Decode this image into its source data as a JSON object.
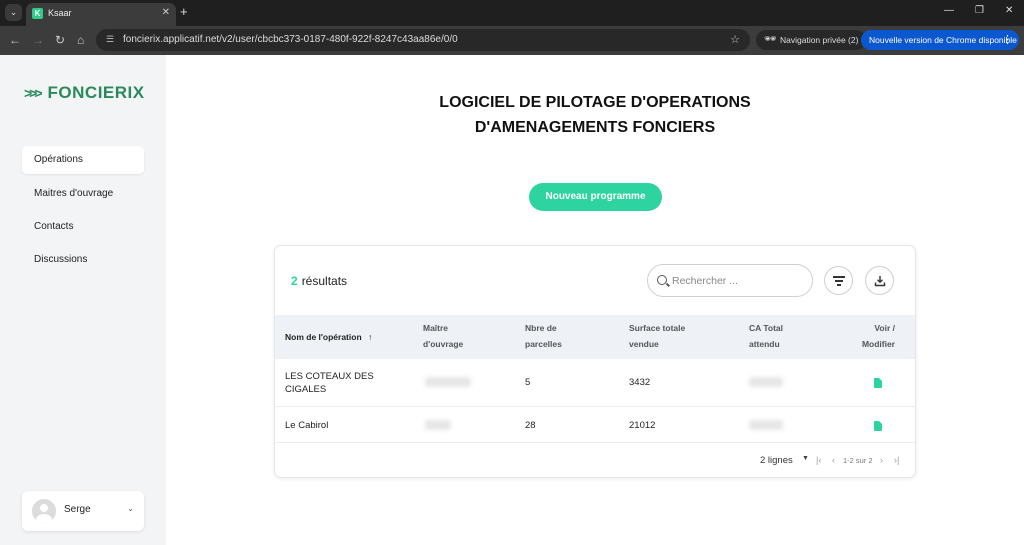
{
  "browser": {
    "tab_title": "Ksaar",
    "url": "foncierix.applicatif.net/v2/user/cbcbc373-0187-480f-922f-8247c43aa86e/0/0",
    "incognito_label": "Navigation privée (2)",
    "update_label": "Nouvelle version de Chrome disponible"
  },
  "sidebar": {
    "logo_text": "FONCIERIX",
    "nav": [
      {
        "label": "Opérations",
        "active": true
      },
      {
        "label": "Maitres d'ouvrage",
        "active": false
      },
      {
        "label": "Contacts",
        "active": false
      },
      {
        "label": "Discussions",
        "active": false
      }
    ],
    "user": {
      "name": "Serge"
    }
  },
  "main": {
    "title_line1": "LOGICIEL DE PILOTAGE D'OPERATIONS",
    "title_line2": "D'AMENAGEMENTS FONCIERS",
    "new_program_label": "Nouveau programme"
  },
  "table": {
    "result_count": "2",
    "result_label": "résultats",
    "search_placeholder": "Rechercher ...",
    "columns": {
      "name": "Nom de l'opération",
      "maitre_l1": "Maître",
      "maitre_l2": "d'ouvrage",
      "parcelles_l1": "Nbre de",
      "parcelles_l2": "parcelles",
      "surface_l1": "Surface totale",
      "surface_l2": "vendue",
      "ca_l1": "CA Total",
      "ca_l2": "attendu",
      "voir_l1": "Voir /",
      "voir_l2": "Modifier"
    },
    "rows": [
      {
        "name_l1": "LES COTEAUX DES",
        "name_l2": "CIGALES",
        "parcelles": "5",
        "surface": "3432"
      },
      {
        "name_l1": "Le Cabirol",
        "name_l2": "",
        "parcelles": "28",
        "surface": "21012"
      }
    ],
    "pagination": {
      "rows_label": "2 lignes",
      "range_label": "1-2 sur 2"
    }
  },
  "colors": {
    "accent": "#2dd4a0",
    "brand": "#2a8a5c",
    "sidebar_bg": "#f3f4f6",
    "header_bg": "#eef1f6"
  }
}
